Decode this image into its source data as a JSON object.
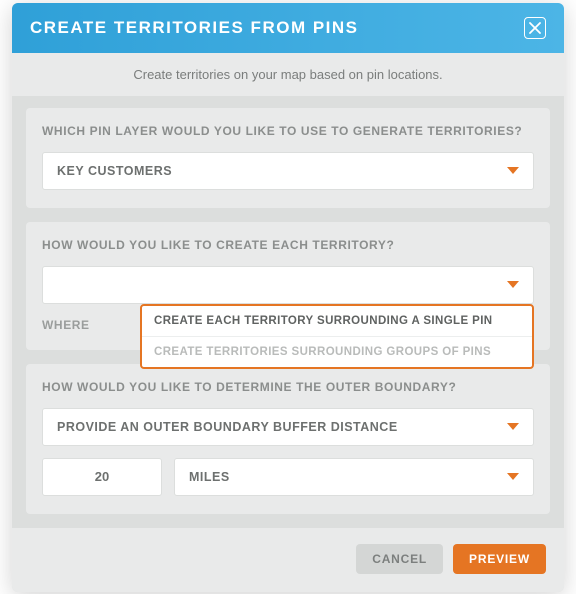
{
  "header": {
    "title": "CREATE TERRITORIES FROM PINS"
  },
  "subtitle": "Create territories on your map based on pin locations.",
  "sections": {
    "pin_layer": {
      "label": "WHICH PIN LAYER WOULD YOU LIKE TO USE TO GENERATE TERRITORIES?",
      "selected": "KEY CUSTOMERS"
    },
    "create_method": {
      "label": "HOW WOULD YOU LIKE TO CREATE EACH TERRITORY?",
      "selected": "",
      "where_label": "WHERE",
      "options": {
        "opt1": "CREATE EACH TERRITORY SURROUNDING A SINGLE PIN",
        "opt2": "CREATE TERRITORIES SURROUNDING GROUPS OF PINS"
      }
    },
    "boundary": {
      "label": "HOW WOULD YOU LIKE TO DETERMINE THE OUTER BOUNDARY?",
      "selected": "PROVIDE AN OUTER BOUNDARY BUFFER DISTANCE",
      "distance": "20",
      "unit": "MILES"
    }
  },
  "footer": {
    "cancel": "CANCEL",
    "preview": "PREVIEW"
  }
}
